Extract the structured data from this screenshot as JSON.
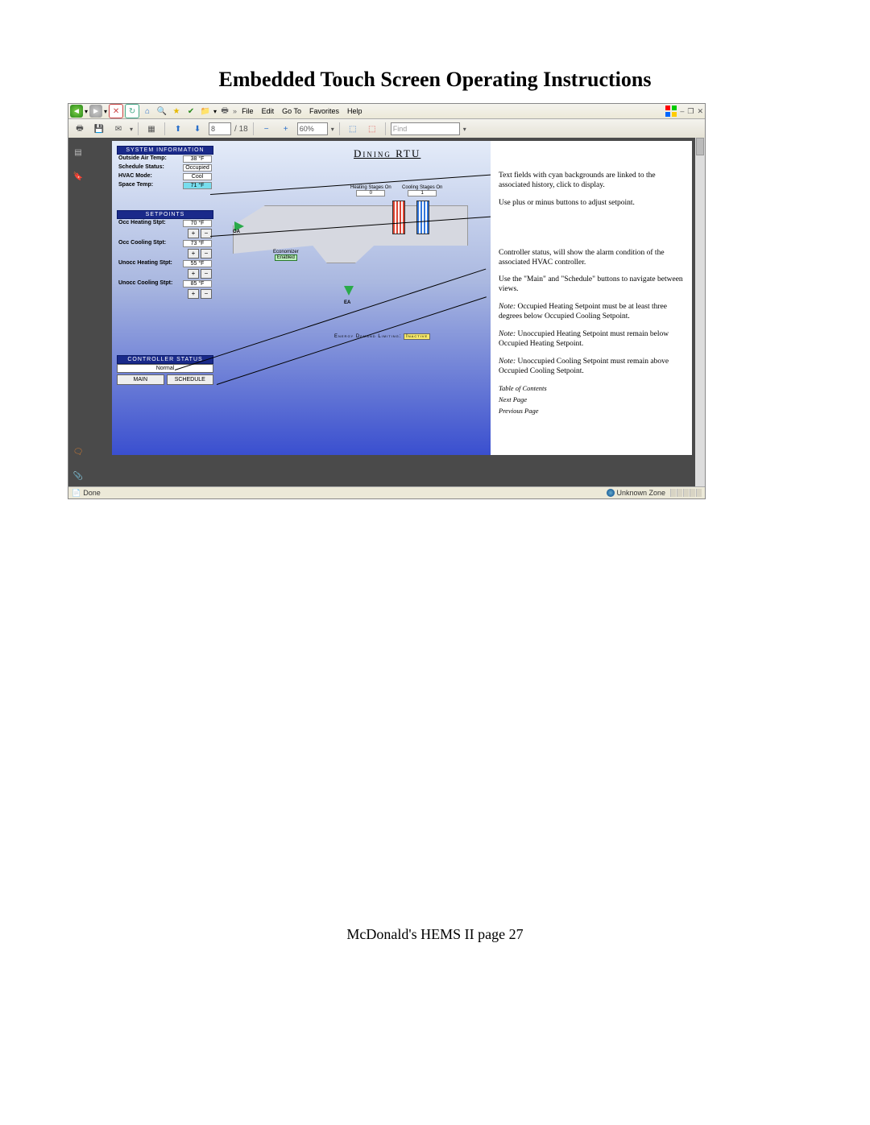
{
  "doc": {
    "title": "Embedded Touch Screen Operating Instructions",
    "footer": "McDonald's HEMS II page 27"
  },
  "ie": {
    "menus": [
      "File",
      "Edit",
      "Go To",
      "Favorites",
      "Help"
    ],
    "status_left": "Done",
    "status_right": "Unknown Zone"
  },
  "pdf": {
    "page_current": "8",
    "page_total": "/ 18",
    "zoom": "60%",
    "find_placeholder": "Find"
  },
  "hvac": {
    "area_title": "Dining  RTU",
    "sysinfo": {
      "header": "SYSTEM INFORMATION",
      "rows": [
        {
          "label": "Outside Air Temp:",
          "value": "38 °F",
          "cyan": false
        },
        {
          "label": "Schedule Status:",
          "value": "Occupied",
          "cyan": false
        },
        {
          "label": "HVAC Mode:",
          "value": "Cool",
          "cyan": false
        },
        {
          "label": "Space Temp:",
          "value": "71 °F",
          "cyan": true
        }
      ]
    },
    "setpoints": {
      "header": "SETPOINTS",
      "rows": [
        {
          "label": "Occ Heating Stpt:",
          "value": "70 °F"
        },
        {
          "label": "Occ Cooling Stpt:",
          "value": "73 °F"
        },
        {
          "label": "Unocc Heating Stpt:",
          "value": "55 °F"
        },
        {
          "label": "Unocc Cooling Stpt:",
          "value": "85 °F"
        }
      ]
    },
    "controller": {
      "header": "CONTROLLER STATUS",
      "value": "Normal"
    },
    "nav": {
      "main": "MAIN",
      "schedule": "SCHEDULE"
    },
    "economizer": {
      "label": "Economizer",
      "value": "Enabled"
    },
    "oa": "OA",
    "ea": "EA",
    "heating_stages": {
      "label": "Heating Stages On",
      "value": "0"
    },
    "cooling_stages": {
      "label": "Cooling Stages On",
      "value": "1"
    },
    "edl": {
      "label": "Energy Demand Limiting:",
      "value": "Inactive"
    }
  },
  "callouts": {
    "c1": "Text fields with cyan backgrounds are linked to the associated history, click to display.",
    "c2": "Use plus or minus buttons to adjust setpoint.",
    "c3": "Controller status, will show the alarm condition of the associated HVAC controller.",
    "c4": "Use the \"Main\" and \"Schedule\" buttons to navigate between views.",
    "n1": "Note: Occupied Heating Setpoint must be at least three degrees below Occupied Cooling Setpoint.",
    "n2": "Note: Unoccupied Heating Setpoint must remain below Occupied Heating Setpoint.",
    "n3": "Note: Unoccupied Cooling Setpoint must remain above Occupied Cooling Setpoint.",
    "link_toc": "Table of Contents",
    "link_next": "Next Page",
    "link_prev": "Previous Page"
  }
}
